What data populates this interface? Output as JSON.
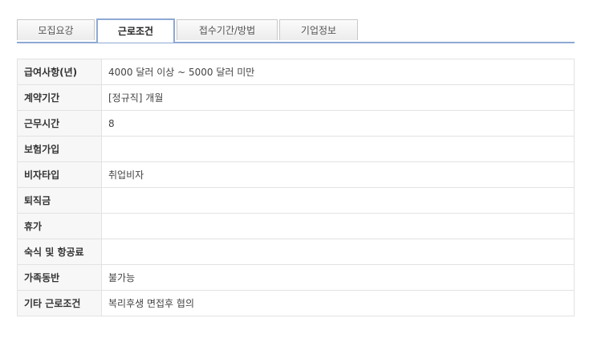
{
  "tabs": [
    {
      "label": "모집요강",
      "active": false
    },
    {
      "label": "근로조건",
      "active": true
    },
    {
      "label": "접수기간/방법",
      "active": false
    },
    {
      "label": "기업정보",
      "active": false
    }
  ],
  "conditions": {
    "rows": [
      {
        "label": "급여사항(년)",
        "value": "4000 달러 이상 ~ 5000 달러 미만"
      },
      {
        "label": "계약기간",
        "value": "[정규직] 개월"
      },
      {
        "label": "근무시간",
        "value": "8"
      },
      {
        "label": "보험가입",
        "value": ""
      },
      {
        "label": "비자타입",
        "value": "취업비자"
      },
      {
        "label": "퇴직금",
        "value": ""
      },
      {
        "label": "휴가",
        "value": ""
      },
      {
        "label": "숙식 및 항공료",
        "value": ""
      },
      {
        "label": "가족동반",
        "value": "불가능"
      },
      {
        "label": "기타 근로조건",
        "value": "복리후생 면접후 협의"
      }
    ]
  },
  "colors": {
    "tab_accent": "#8ea9d4",
    "label_background": "#f7f7f7",
    "border": "#e2e2e2"
  }
}
